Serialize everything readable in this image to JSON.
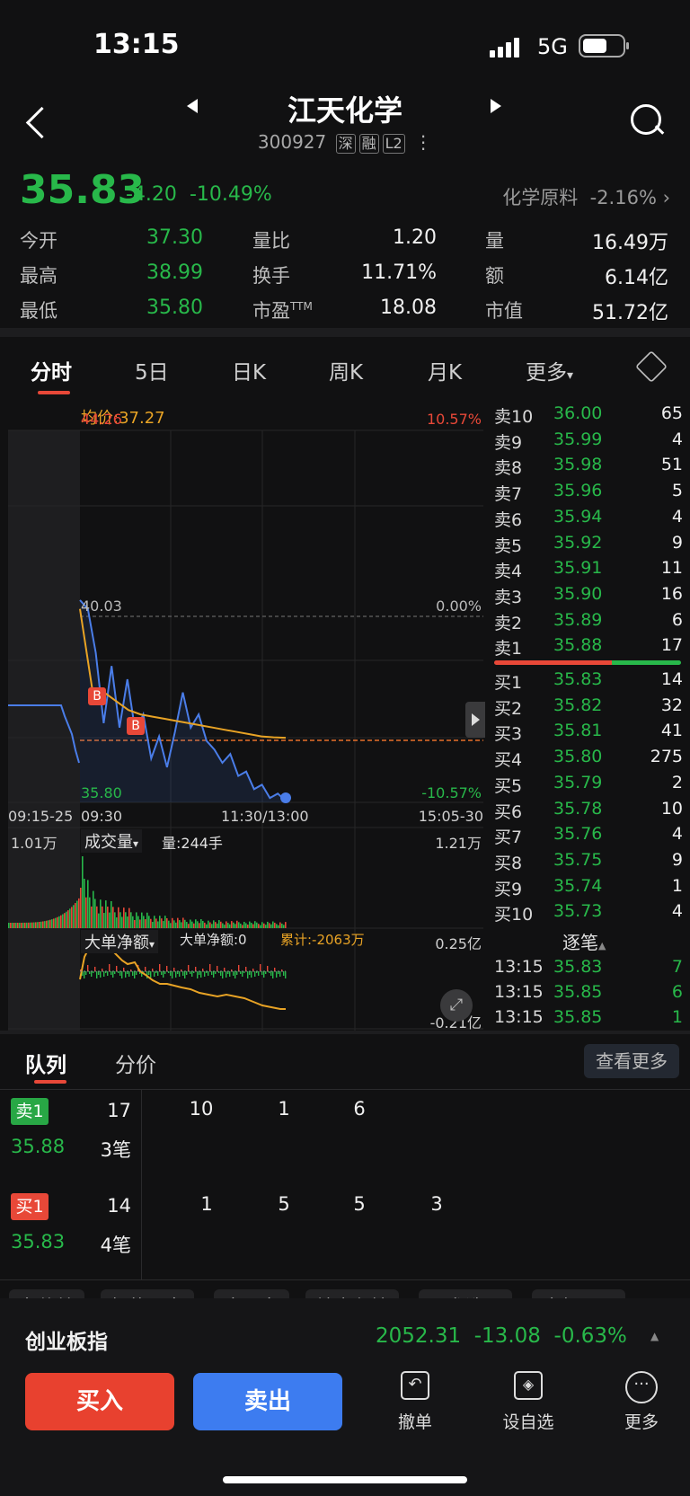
{
  "status": {
    "time": "13:15",
    "network": "5G"
  },
  "header": {
    "title": "江天化学",
    "code": "300927",
    "tags": [
      "深",
      "融",
      "L2"
    ]
  },
  "quote": {
    "price": "35.83",
    "change": "-4.20",
    "change_pct": "-10.49%",
    "sector": "化学原料",
    "sector_pct": "-2.16%"
  },
  "stats": [
    {
      "label": "今开",
      "value": "37.30",
      "color": "g"
    },
    {
      "label": "量比",
      "value": "1.20",
      "color": "w"
    },
    {
      "label": "量",
      "value": "16.49万",
      "color": "w"
    },
    {
      "label": "最高",
      "value": "38.99",
      "color": "g"
    },
    {
      "label": "换手",
      "value": "11.71%",
      "color": "w"
    },
    {
      "label": "额",
      "value": "6.14亿",
      "color": "w"
    },
    {
      "label": "最低",
      "value": "35.80",
      "color": "g"
    },
    {
      "label": "市盈TTM",
      "value": "18.08",
      "color": "w"
    },
    {
      "label": "市值",
      "value": "51.72亿",
      "color": "w"
    }
  ],
  "chart_tabs": [
    "分时",
    "5日",
    "日K",
    "周K",
    "月K",
    "更多"
  ],
  "chart": {
    "avg_label": "均价:37.27",
    "high": "44.26",
    "high_pct": "10.57%",
    "mid": "40.03",
    "mid_pct": "0.00%",
    "low": "35.80",
    "low_pct": "-10.57%",
    "x_labels": [
      "09:15-25",
      "09:30",
      "11:30/13:00",
      "15:05-30"
    ],
    "vol_left": "1.01万",
    "vol_title": "成交量",
    "vol_info": "量:244手",
    "vol_right": "1.21万",
    "flow_title": "大单净额",
    "flow_info": "大单净额:0",
    "flow_cum": "累计:-2063万",
    "flow_top": "0.25亿",
    "flow_bot": "-0.21亿",
    "marker": "B"
  },
  "chart_data": {
    "type": "line",
    "y_range": [
      35.8,
      44.26
    ],
    "series": [
      {
        "name": "price",
        "values": [
          40.4,
          40.2,
          39.2,
          37.6,
          38.9,
          37.5,
          38.6,
          37.4,
          37.8,
          36.8,
          37.3,
          36.6,
          37.4,
          38.3,
          37.5,
          37.8,
          37.2,
          37.0,
          36.7,
          36.9,
          36.4,
          36.5,
          36.1,
          36.2,
          35.9,
          36.0,
          35.83
        ]
      },
      {
        "name": "avg",
        "values": [
          40.2,
          38.4,
          38.3,
          38.1,
          37.9,
          37.8,
          37.75,
          37.7,
          37.65,
          37.6,
          37.55,
          37.5,
          37.45,
          37.4,
          37.35,
          37.3,
          37.28,
          37.27
        ]
      }
    ]
  },
  "orderbook": {
    "sells": [
      {
        "label": "卖10",
        "price": "36.00",
        "vol": "65"
      },
      {
        "label": "卖9",
        "price": "35.99",
        "vol": "4"
      },
      {
        "label": "卖8",
        "price": "35.98",
        "vol": "51"
      },
      {
        "label": "卖7",
        "price": "35.96",
        "vol": "5"
      },
      {
        "label": "卖6",
        "price": "35.94",
        "vol": "4"
      },
      {
        "label": "卖5",
        "price": "35.92",
        "vol": "9"
      },
      {
        "label": "卖4",
        "price": "35.91",
        "vol": "11"
      },
      {
        "label": "卖3",
        "price": "35.90",
        "vol": "16"
      },
      {
        "label": "卖2",
        "price": "35.89",
        "vol": "6"
      },
      {
        "label": "卖1",
        "price": "35.88",
        "vol": "17"
      }
    ],
    "buys": [
      {
        "label": "买1",
        "price": "35.83",
        "vol": "14"
      },
      {
        "label": "买2",
        "price": "35.82",
        "vol": "32"
      },
      {
        "label": "买3",
        "price": "35.81",
        "vol": "41"
      },
      {
        "label": "买4",
        "price": "35.80",
        "vol": "275"
      },
      {
        "label": "买5",
        "price": "35.79",
        "vol": "2"
      },
      {
        "label": "买6",
        "price": "35.78",
        "vol": "10"
      },
      {
        "label": "买7",
        "price": "35.76",
        "vol": "4"
      },
      {
        "label": "买8",
        "price": "35.75",
        "vol": "9"
      },
      {
        "label": "买9",
        "price": "35.74",
        "vol": "1"
      },
      {
        "label": "买10",
        "price": "35.73",
        "vol": "4"
      }
    ],
    "ticks_title": "逐笔",
    "ticks": [
      {
        "time": "13:15",
        "price": "35.83",
        "vol": "7",
        "color": "g"
      },
      {
        "time": "13:15",
        "price": "35.85",
        "vol": "6",
        "color": "g"
      },
      {
        "time": "13:15",
        "price": "35.85",
        "vol": "1",
        "color": "g"
      }
    ]
  },
  "queue": {
    "tabs": [
      "队列",
      "分价"
    ],
    "more": "查看更多",
    "sell": {
      "badge": "卖1",
      "total": "17",
      "price": "35.88",
      "count": "3笔",
      "items": [
        "10",
        "1",
        "6"
      ]
    },
    "buy": {
      "badge": "买1",
      "total": "14",
      "price": "35.83",
      "count": "4笔",
      "items": [
        "1",
        "5",
        "5",
        "3"
      ]
    }
  },
  "tools": [
    "条件单",
    "智能盯盘",
    "交易宝",
    "神奇九转",
    "云参选股",
    "全部工具"
  ],
  "index": {
    "name": "创业板指",
    "value": "2052.31",
    "change": "-13.08",
    "pct": "-0.63%"
  },
  "actions": {
    "buy": "买入",
    "sell": "卖出",
    "cancel": "撤单",
    "watch": "设自选",
    "more": "更多"
  }
}
